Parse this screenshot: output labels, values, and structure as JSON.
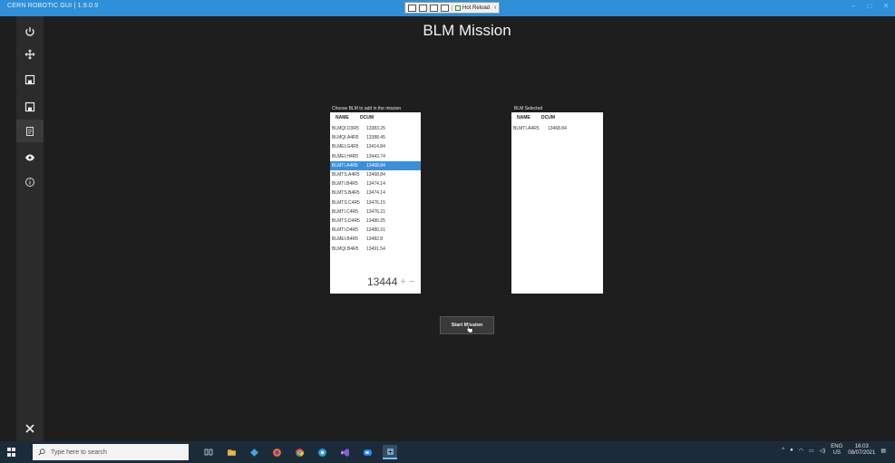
{
  "window": {
    "title": "CERN ROBOTIC GUI | 1.9.0.9",
    "devtools_hot_reload": "Hot Reload"
  },
  "sidebar": {
    "items": [
      {
        "icon": "power-icon"
      },
      {
        "icon": "move-icon"
      },
      {
        "icon": "save-icon"
      },
      {
        "icon": "save-icon"
      },
      {
        "icon": "mission-icon"
      },
      {
        "icon": "eye-icon"
      },
      {
        "icon": "info-icon"
      }
    ],
    "bottom_icon": "tools-icon"
  },
  "page": {
    "title": "BLM Mission"
  },
  "available": {
    "label": "Choose BLM to add in the mission",
    "col_name": "NAME",
    "col_dcum": "DCUM",
    "rows": [
      {
        "name": "BLMQI.D3R5",
        "dcum": "13383.25",
        "selected": false
      },
      {
        "name": "BLMQI.A4R5",
        "dcum": "13388.45",
        "selected": false
      },
      {
        "name": "BLMEI.G4R5",
        "dcum": "13414.84",
        "selected": false
      },
      {
        "name": "BLMEI.H4R5",
        "dcum": "13443.74",
        "selected": false
      },
      {
        "name": "BLMTI.A4R5",
        "dcum": "13468.84",
        "selected": true
      },
      {
        "name": "BLMTS.A4R5",
        "dcum": "13468.84",
        "selected": false
      },
      {
        "name": "BLMTI.B4R5",
        "dcum": "13474.14",
        "selected": false
      },
      {
        "name": "BLMTS.B4R5",
        "dcum": "13474.14",
        "selected": false
      },
      {
        "name": "BLMTS.C4R5",
        "dcum": "13476.15",
        "selected": false
      },
      {
        "name": "BLMTI.C4R5",
        "dcum": "13476.21",
        "selected": false
      },
      {
        "name": "BLMTS.D4R5",
        "dcum": "13480.25",
        "selected": false
      },
      {
        "name": "BLMTI.D4R5",
        "dcum": "13480.31",
        "selected": false
      },
      {
        "name": "BLMEI.B4R5",
        "dcum": "13482.8",
        "selected": false
      },
      {
        "name": "BLMQI.B4R5",
        "dcum": "13491.54",
        "selected": false
      }
    ],
    "stepper_value": "13444",
    "plus": "+",
    "minus": "−"
  },
  "selected": {
    "label": "BLM Selected",
    "col_name": "NAME",
    "col_dcum": "DCUM",
    "rows": [
      {
        "name": "BLMTI.A4R5",
        "dcum": "13468.84"
      }
    ]
  },
  "actions": {
    "start_label": "Start Mission"
  },
  "taskbar": {
    "search_placeholder": "Type here to search",
    "lang_top": "ENG",
    "lang_bottom": "US",
    "time": "16:03",
    "date": "08/07/2021"
  },
  "colors": {
    "titlebar": "#2f8fd8",
    "selection": "#3d8ed8",
    "background": "#1e1e1e"
  }
}
